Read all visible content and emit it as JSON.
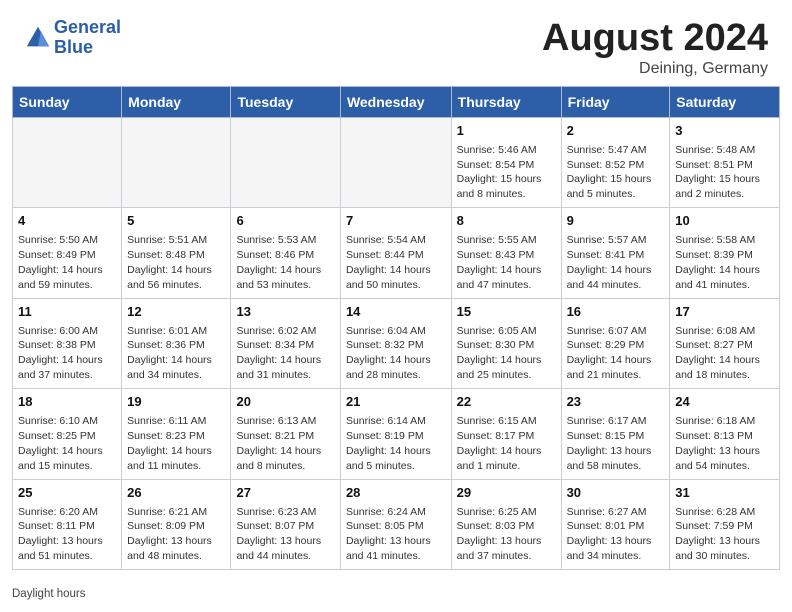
{
  "header": {
    "logo_line1": "General",
    "logo_line2": "Blue",
    "month_title": "August 2024",
    "location": "Deining, Germany"
  },
  "weekdays": [
    "Sunday",
    "Monday",
    "Tuesday",
    "Wednesday",
    "Thursday",
    "Friday",
    "Saturday"
  ],
  "weeks": [
    [
      {
        "day": "",
        "info": ""
      },
      {
        "day": "",
        "info": ""
      },
      {
        "day": "",
        "info": ""
      },
      {
        "day": "",
        "info": ""
      },
      {
        "day": "1",
        "info": "Sunrise: 5:46 AM\nSunset: 8:54 PM\nDaylight: 15 hours\nand 8 minutes."
      },
      {
        "day": "2",
        "info": "Sunrise: 5:47 AM\nSunset: 8:52 PM\nDaylight: 15 hours\nand 5 minutes."
      },
      {
        "day": "3",
        "info": "Sunrise: 5:48 AM\nSunset: 8:51 PM\nDaylight: 15 hours\nand 2 minutes."
      }
    ],
    [
      {
        "day": "4",
        "info": "Sunrise: 5:50 AM\nSunset: 8:49 PM\nDaylight: 14 hours\nand 59 minutes."
      },
      {
        "day": "5",
        "info": "Sunrise: 5:51 AM\nSunset: 8:48 PM\nDaylight: 14 hours\nand 56 minutes."
      },
      {
        "day": "6",
        "info": "Sunrise: 5:53 AM\nSunset: 8:46 PM\nDaylight: 14 hours\nand 53 minutes."
      },
      {
        "day": "7",
        "info": "Sunrise: 5:54 AM\nSunset: 8:44 PM\nDaylight: 14 hours\nand 50 minutes."
      },
      {
        "day": "8",
        "info": "Sunrise: 5:55 AM\nSunset: 8:43 PM\nDaylight: 14 hours\nand 47 minutes."
      },
      {
        "day": "9",
        "info": "Sunrise: 5:57 AM\nSunset: 8:41 PM\nDaylight: 14 hours\nand 44 minutes."
      },
      {
        "day": "10",
        "info": "Sunrise: 5:58 AM\nSunset: 8:39 PM\nDaylight: 14 hours\nand 41 minutes."
      }
    ],
    [
      {
        "day": "11",
        "info": "Sunrise: 6:00 AM\nSunset: 8:38 PM\nDaylight: 14 hours\nand 37 minutes."
      },
      {
        "day": "12",
        "info": "Sunrise: 6:01 AM\nSunset: 8:36 PM\nDaylight: 14 hours\nand 34 minutes."
      },
      {
        "day": "13",
        "info": "Sunrise: 6:02 AM\nSunset: 8:34 PM\nDaylight: 14 hours\nand 31 minutes."
      },
      {
        "day": "14",
        "info": "Sunrise: 6:04 AM\nSunset: 8:32 PM\nDaylight: 14 hours\nand 28 minutes."
      },
      {
        "day": "15",
        "info": "Sunrise: 6:05 AM\nSunset: 8:30 PM\nDaylight: 14 hours\nand 25 minutes."
      },
      {
        "day": "16",
        "info": "Sunrise: 6:07 AM\nSunset: 8:29 PM\nDaylight: 14 hours\nand 21 minutes."
      },
      {
        "day": "17",
        "info": "Sunrise: 6:08 AM\nSunset: 8:27 PM\nDaylight: 14 hours\nand 18 minutes."
      }
    ],
    [
      {
        "day": "18",
        "info": "Sunrise: 6:10 AM\nSunset: 8:25 PM\nDaylight: 14 hours\nand 15 minutes."
      },
      {
        "day": "19",
        "info": "Sunrise: 6:11 AM\nSunset: 8:23 PM\nDaylight: 14 hours\nand 11 minutes."
      },
      {
        "day": "20",
        "info": "Sunrise: 6:13 AM\nSunset: 8:21 PM\nDaylight: 14 hours\nand 8 minutes."
      },
      {
        "day": "21",
        "info": "Sunrise: 6:14 AM\nSunset: 8:19 PM\nDaylight: 14 hours\nand 5 minutes."
      },
      {
        "day": "22",
        "info": "Sunrise: 6:15 AM\nSunset: 8:17 PM\nDaylight: 14 hours\nand 1 minute."
      },
      {
        "day": "23",
        "info": "Sunrise: 6:17 AM\nSunset: 8:15 PM\nDaylight: 13 hours\nand 58 minutes."
      },
      {
        "day": "24",
        "info": "Sunrise: 6:18 AM\nSunset: 8:13 PM\nDaylight: 13 hours\nand 54 minutes."
      }
    ],
    [
      {
        "day": "25",
        "info": "Sunrise: 6:20 AM\nSunset: 8:11 PM\nDaylight: 13 hours\nand 51 minutes."
      },
      {
        "day": "26",
        "info": "Sunrise: 6:21 AM\nSunset: 8:09 PM\nDaylight: 13 hours\nand 48 minutes."
      },
      {
        "day": "27",
        "info": "Sunrise: 6:23 AM\nSunset: 8:07 PM\nDaylight: 13 hours\nand 44 minutes."
      },
      {
        "day": "28",
        "info": "Sunrise: 6:24 AM\nSunset: 8:05 PM\nDaylight: 13 hours\nand 41 minutes."
      },
      {
        "day": "29",
        "info": "Sunrise: 6:25 AM\nSunset: 8:03 PM\nDaylight: 13 hours\nand 37 minutes."
      },
      {
        "day": "30",
        "info": "Sunrise: 6:27 AM\nSunset: 8:01 PM\nDaylight: 13 hours\nand 34 minutes."
      },
      {
        "day": "31",
        "info": "Sunrise: 6:28 AM\nSunset: 7:59 PM\nDaylight: 13 hours\nand 30 minutes."
      }
    ]
  ],
  "footer": {
    "daylight_label": "Daylight hours"
  }
}
